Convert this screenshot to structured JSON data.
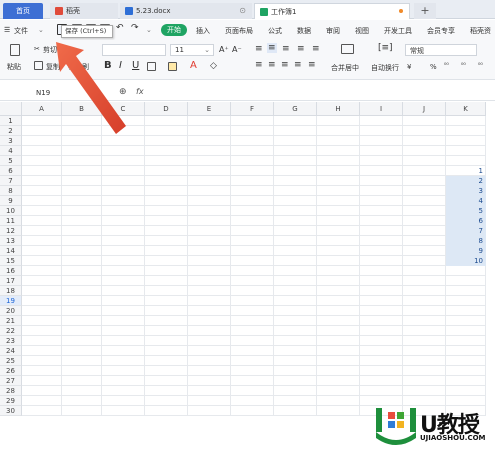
{
  "tabs": [
    {
      "label": "首页",
      "kind": "home"
    },
    {
      "label": "稻壳",
      "kind": "daoke"
    },
    {
      "label": "5.23.docx",
      "kind": "docx"
    },
    {
      "label": "工作簿1",
      "kind": "sheet"
    }
  ],
  "menu": {
    "file": "文件",
    "start": "开始",
    "items": [
      "插入",
      "页面布局",
      "公式",
      "数据",
      "审阅",
      "视图",
      "开发工具",
      "会员专享",
      "稻壳资"
    ]
  },
  "tooltip": "保存 (Ctrl+S)",
  "ribbon": {
    "paste": "粘贴",
    "cut": "剪切",
    "copy": "复制",
    "format_painter": "格式刷",
    "font_size": "11",
    "merge_center": "合并居中",
    "wrap_text": "自动换行",
    "number_format": "常规",
    "percent": "%"
  },
  "formula_bar": {
    "name_box": "N19",
    "fx": "fx"
  },
  "grid": {
    "columns": [
      "A",
      "B",
      "C",
      "D",
      "E",
      "F",
      "G",
      "H",
      "I",
      "J",
      "K"
    ],
    "rows": [
      "1",
      "2",
      "3",
      "4",
      "5",
      "6",
      "7",
      "8",
      "9",
      "10",
      "11",
      "12",
      "13",
      "14",
      "15",
      "16",
      "17",
      "18",
      "19",
      "20",
      "21",
      "22",
      "23",
      "24",
      "25",
      "26",
      "27",
      "28",
      "29",
      "30"
    ],
    "selected_row": "19",
    "k_values": [
      "1",
      "2",
      "3",
      "4",
      "5",
      "6",
      "7",
      "8",
      "9",
      "10"
    ],
    "k_start_row": 6
  },
  "watermark": {
    "brand": "U教授",
    "url": "UJIAOSHOU.COM"
  },
  "colors": {
    "accent": "#1fa463",
    "home_tab": "#3d6fd4",
    "arrow": "#e8553c"
  }
}
